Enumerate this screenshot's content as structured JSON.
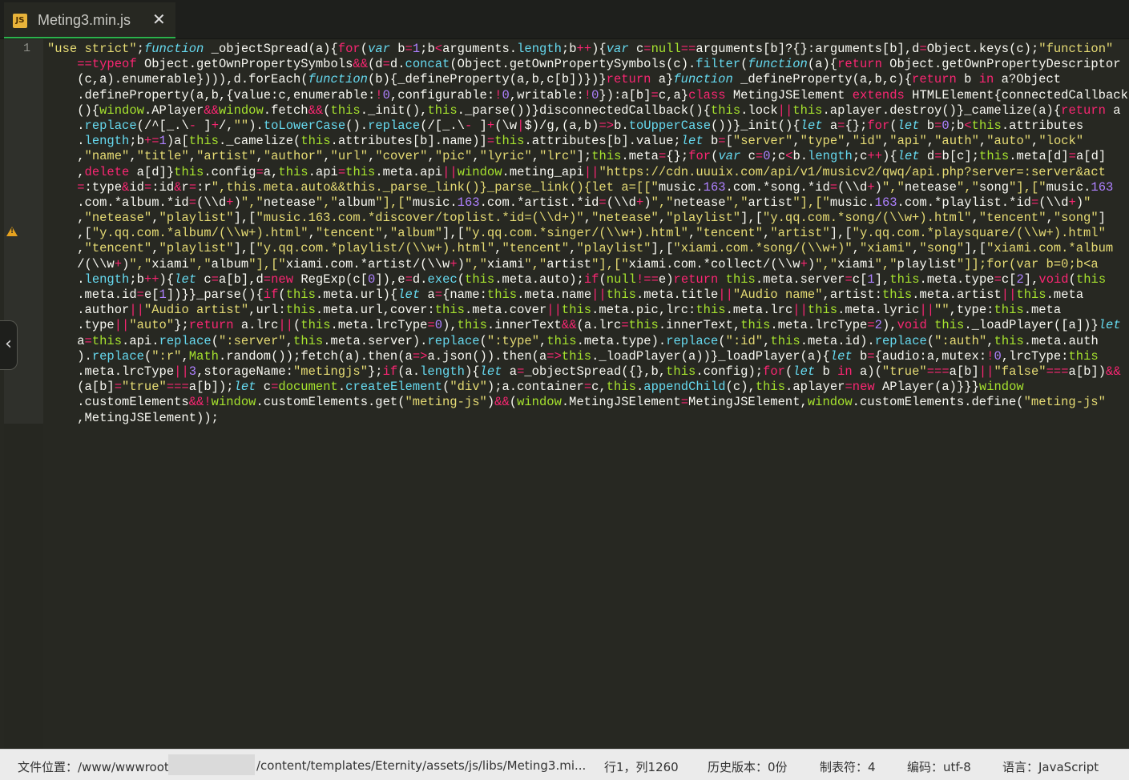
{
  "tab": {
    "icon": "JS",
    "title": "Meting3.min.js",
    "close": "✕"
  },
  "gutter": {
    "line_number": "1"
  },
  "code_lines": [
    "\"use strict\";function _objectSpread(a){for(var b=1;b<arguments.length;b++){var c=null==arguments[b]?{}:arguments[b],d=Object.keys(c);\"function\"",
    "    ==typeof Object.getOwnPropertySymbols&&(d=d.concat(Object.getOwnPropertySymbols(c).filter(function(a){return Object.getOwnPropertyDescriptor",
    "    (c,a).enumerable}))),d.forEach(function(b){_defineProperty(a,b,c[b])})}return a}function _defineProperty(a,b,c){return b in a?Object",
    "    .defineProperty(a,b,{value:c,enumerable:!0,configurable:!0,writable:!0}):a[b]=c,a}class MetingJSElement extends HTMLElement{connectedCallback",
    "    (){window.APlayer&&window.fetch&&(this._init(),this._parse())}disconnectedCallback(){this.lock||this.aplayer.destroy()}_camelize(a){return a",
    "    .replace(/^[_.\\- ]+/,\"\").toLowerCase().replace(/[_.\\- ]+(\\w|$)/g,(a,b)=>b.toUpperCase())}_init(){let a={};for(let b=0;b<this.attributes",
    "    .length;b+=1)a[this._camelize(this.attributes[b].name)]=this.attributes[b].value;let b=[\"server\",\"type\",\"id\",\"api\",\"auth\",\"auto\",\"lock\"",
    "    ,\"name\",\"title\",\"artist\",\"author\",\"url\",\"cover\",\"pic\",\"lyric\",\"lrc\"];this.meta={};for(var c=0;c<b.length;c++){let d=b[c];this.meta[d]=a[d]",
    "    ,delete a[d]}this.config=a,this.api=this.meta.api||window.meting_api||\"https://cdn.uuuix.com/api/v1/musicv2/qwq/api.php?server=:server&act",
    "    =:type&id=:id&r=:r\",this.meta.auto&&this._parse_link()}_parse_link(){let a=[[\"music.163.com.*song.*id=(\\\\d+)\",\"netease\",\"song\"],[\"music.163",
    "    .com.*album.*id=(\\\\d+)\",\"netease\",\"album\"],[\"music.163.com.*artist.*id=(\\\\d+)\",\"netease\",\"artist\"],[\"music.163.com.*playlist.*id=(\\\\d+)\"",
    "    ,\"netease\",\"playlist\"],[\"music.163.com.*discover/toplist.*id=(\\\\d+)\",\"netease\",\"playlist\"],[\"y.qq.com.*song/(\\\\w+).html\",\"tencent\",\"song\"]",
    "    ,[\"y.qq.com.*album/(\\\\w+).html\",\"tencent\",\"album\"],[\"y.qq.com.*singer/(\\\\w+).html\",\"tencent\",\"artist\"],[\"y.qq.com.*playsquare/(\\\\w+).html\"",
    "    ,\"tencent\",\"playlist\"],[\"y.qq.com.*playlist/(\\\\w+).html\",\"tencent\",\"playlist\"],[\"xiami.com.*song/(\\\\w+)\",\"xiami\",\"song\"],[\"xiami.com.*album",
    "    /(\\\\w+)\",\"xiami\",\"album\"],[\"xiami.com.*artist/(\\\\w+)\",\"xiami\",\"artist\"],[\"xiami.com.*collect/(\\\\w+)\",\"xiami\",\"playlist\"]];for(var b=0;b<a",
    "    .length;b++){let c=a[b],d=new RegExp(c[0]),e=d.exec(this.meta.auto);if(null!==e)return this.meta.server=c[1],this.meta.type=c[2],void(this",
    "    .meta.id=e[1])}}_parse(){if(this.meta.url){let a={name:this.meta.name||this.meta.title||\"Audio name\",artist:this.meta.artist||this.meta",
    "    .author||\"Audio artist\",url:this.meta.url,cover:this.meta.cover||this.meta.pic,lrc:this.meta.lrc||this.meta.lyric||\"\",type:this.meta",
    "    .type||\"auto\"};return a.lrc||(this.meta.lrcType=0),this.innerText&&(a.lrc=this.innerText,this.meta.lrcType=2),void this._loadPlayer([a])}let",
    "    a=this.api.replace(\":server\",this.meta.server).replace(\":type\",this.meta.type).replace(\":id\",this.meta.id).replace(\":auth\",this.meta.auth",
    "    ).replace(\":r\",Math.random());fetch(a).then(a=>a.json()).then(a=>this._loadPlayer(a))}_loadPlayer(a){let b={audio:a,mutex:!0,lrcType:this",
    "    .meta.lrcType||3,storageName:\"metingjs\"};if(a.length){let a=_objectSpread({},b,this.config);for(let b in a)(\"true\"===a[b]||\"false\"===a[b])&&",
    "    (a[b]=\"true\"===a[b]);let c=document.createElement(\"div\");a.container=c,this.appendChild(c),this.aplayer=new APlayer(a)}}}window",
    "    .customElements&&!window.customElements.get(\"meting-js\")&&(window.MetingJSElement=MetingJSElement,window.customElements.define(\"meting-js\"",
    "    ,MetingJSElement));"
  ],
  "status": {
    "path_prefix": "文件位置：/www/wwwroot/",
    "path_suffix": "/content/templates/Eternity/assets/js/libs/Meting3.mi...",
    "cursor": "行1，列1260",
    "history": "历史版本：0份",
    "tab_size": "制表符：4",
    "encoding": "编码：utf-8",
    "language": "语言：JavaScript"
  },
  "colors": {
    "background": "#272822",
    "keyword": "#f92672",
    "string": "#e6db74",
    "function": "#a6e22e",
    "storage": "#66d9ef",
    "number": "#ae81ff"
  },
  "icons": {
    "warning": "warning-icon",
    "collapse": "chevron-left-icon",
    "close": "close-icon",
    "file_type": "js-file-icon"
  }
}
